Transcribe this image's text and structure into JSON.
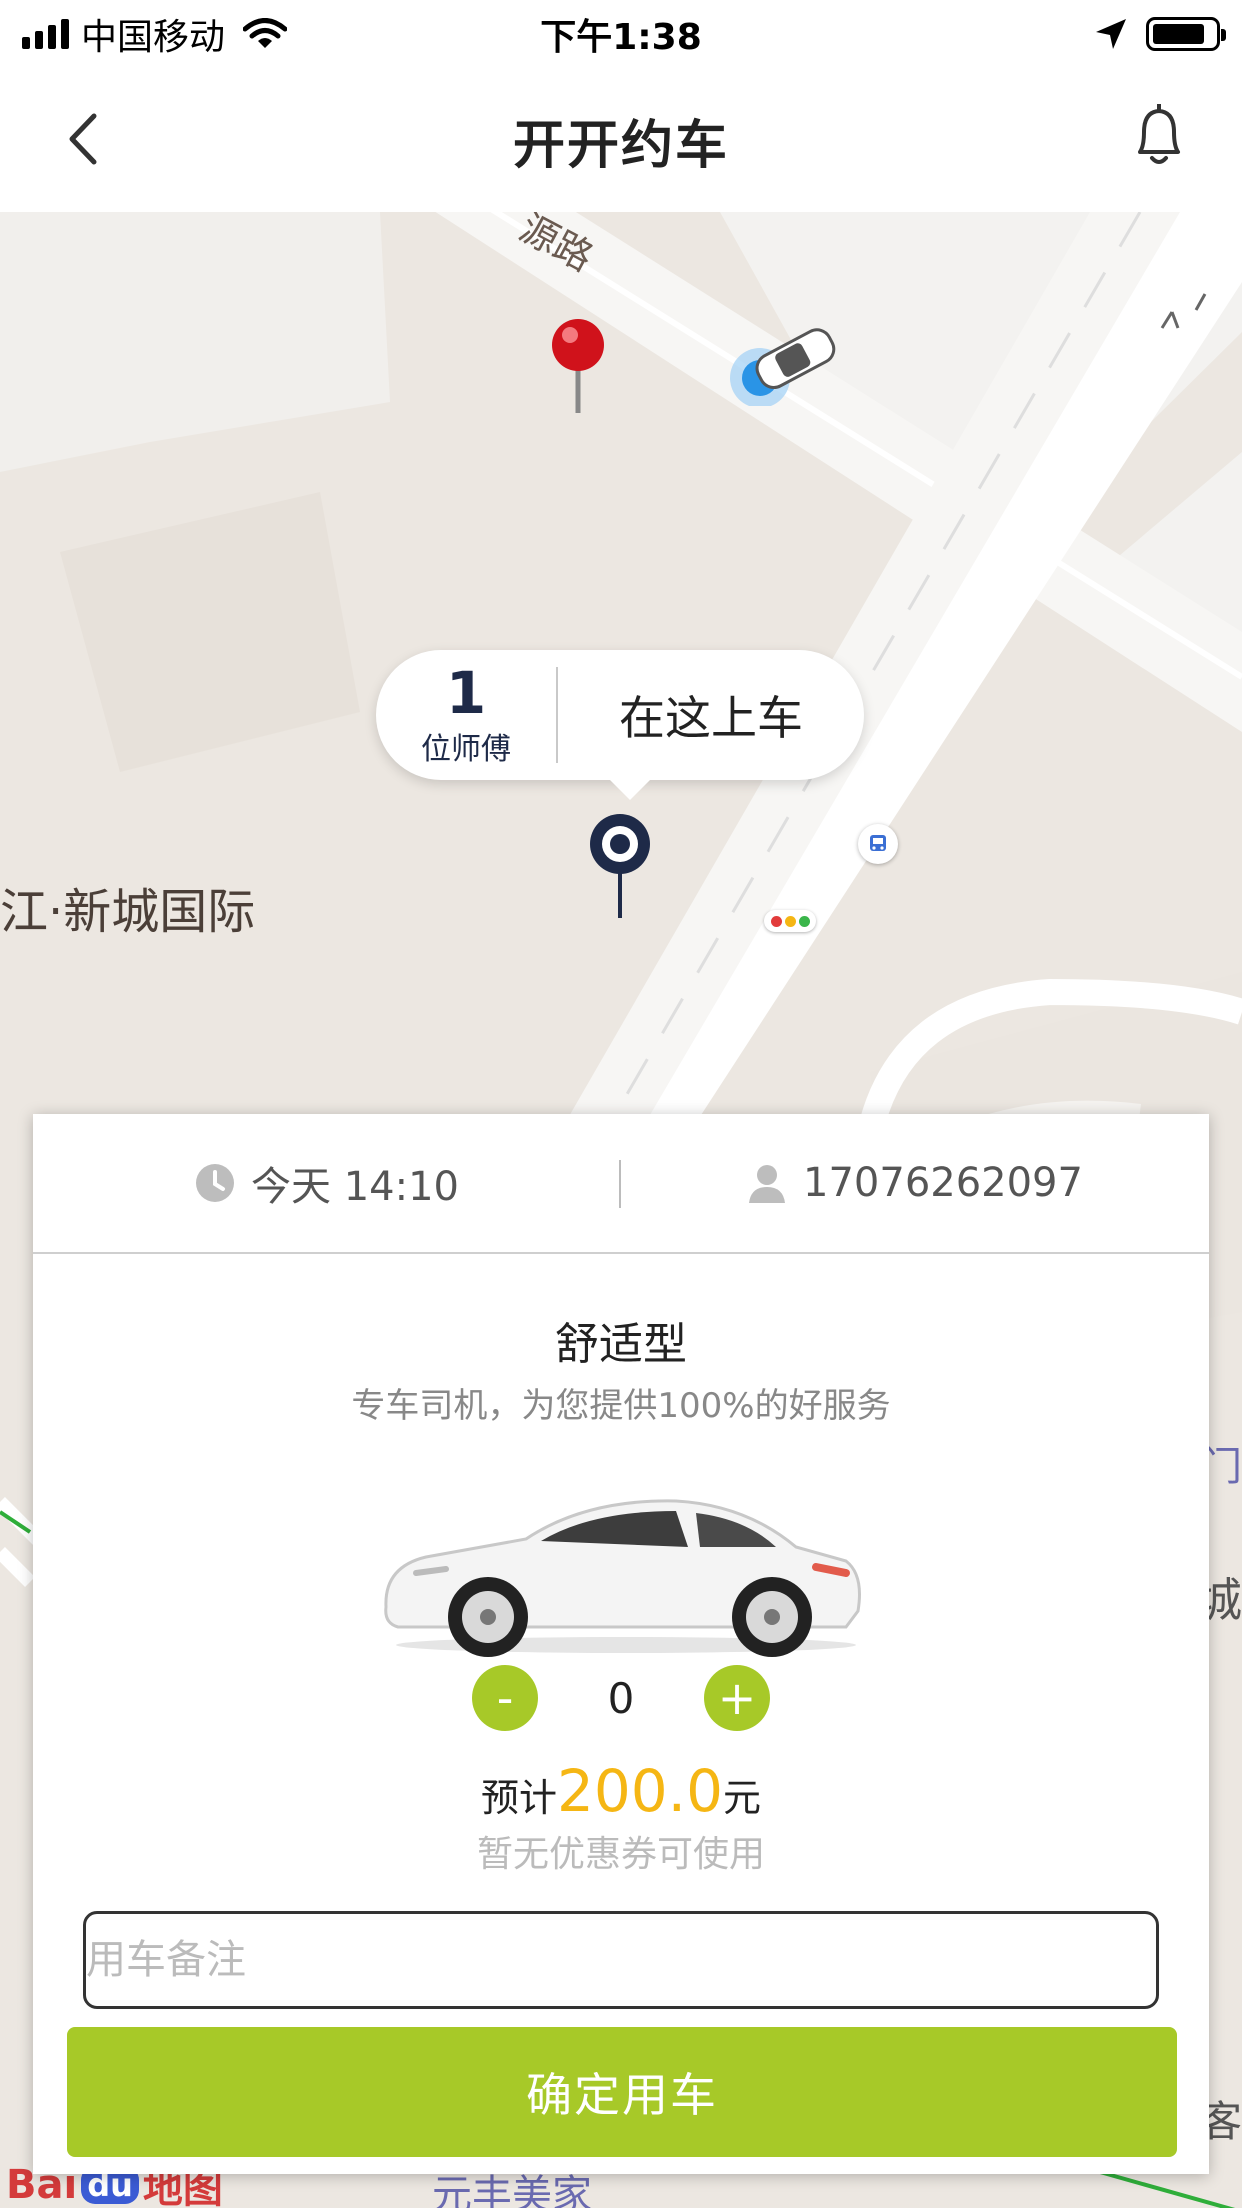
{
  "status_bar": {
    "carrier": "中国移动",
    "time": "下午1:38",
    "battery_level": 0.85
  },
  "nav": {
    "title": "开开约车",
    "back_icon": "chevron-left-icon",
    "bell_icon": "bell-icon"
  },
  "map": {
    "road_label": "源路",
    "place_label": "江·新城国际",
    "right_label_1": "门",
    "right_label_2": "新城",
    "right_label_3": "美客",
    "bottom_label": "元丰美家",
    "bubble": {
      "driver_count": "1",
      "driver_label": "位师傅",
      "action": "在这上车"
    },
    "logo": {
      "bai": "Bai",
      "du": "du",
      "ditu": "地图"
    }
  },
  "order": {
    "time": "今天 14:10",
    "phone": "17076262097",
    "car_type": "舒适型",
    "car_desc": "专车司机，为您提供100%的好服务",
    "minus_label": "-",
    "quantity": "0",
    "plus_label": "+",
    "price_prefix": "预计",
    "price_value": "200.0",
    "price_unit": "元",
    "coupon_text": "暂无优惠券可使用",
    "remark_placeholder": "用车备注",
    "confirm_label": "确定用车"
  },
  "colors": {
    "accent": "#a7c928",
    "price": "#f5b614",
    "map_bg": "#ece7e1"
  }
}
